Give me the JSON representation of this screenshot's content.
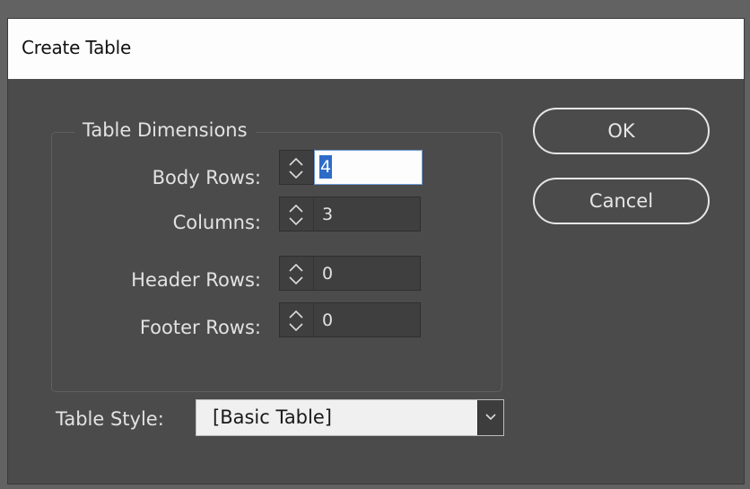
{
  "dialog": {
    "title": "Create Table",
    "group_title": "Table Dimensions",
    "fields": [
      {
        "label": "Body Rows:",
        "value": "4",
        "focused": true
      },
      {
        "label": "Columns:",
        "value": "3"
      },
      {
        "label": "Header Rows:",
        "value": "0"
      },
      {
        "label": "Footer Rows:",
        "value": "0"
      }
    ],
    "buttons": {
      "ok": "OK",
      "cancel": "Cancel"
    },
    "table_style": {
      "label": "Table Style:",
      "value": "[Basic Table]"
    }
  },
  "icons": {
    "spinner": "up-down-arrows-icon",
    "dropdown": "chevron-down-icon"
  },
  "colors": {
    "dialog_bg": "#4b4b4b",
    "titlebar_bg": "#fdfdfd",
    "focus_highlight": "#2d6bc8"
  }
}
